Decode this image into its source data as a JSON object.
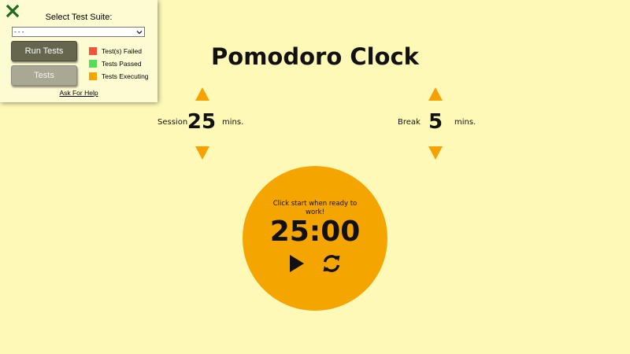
{
  "test_panel": {
    "close_icon": "x-close-icon",
    "close_color": "#1e6b1e",
    "suite_label": "Select Test Suite:",
    "suite_selected": "- - -",
    "run_button": "Run Tests",
    "tests_button": "Tests",
    "legend": [
      {
        "label": "Test(s) Failed",
        "color": "#f0553c"
      },
      {
        "label": "Tests Passed",
        "color": "#55dd55"
      },
      {
        "label": "Tests Executing",
        "color": "#f5a500"
      }
    ],
    "help_link": "Ask For Help"
  },
  "app": {
    "title": "Pomodoro Clock",
    "accent_color": "#f5a500",
    "background_color": "#fff9b8",
    "session": {
      "label": "Session",
      "value": "25",
      "unit": "mins."
    },
    "break": {
      "label": "Break",
      "value": "5",
      "unit": "mins."
    },
    "timer": {
      "message": "Click start when ready to work!",
      "time": "25:00",
      "play_icon": "play-icon",
      "reset_icon": "refresh-icon"
    }
  }
}
